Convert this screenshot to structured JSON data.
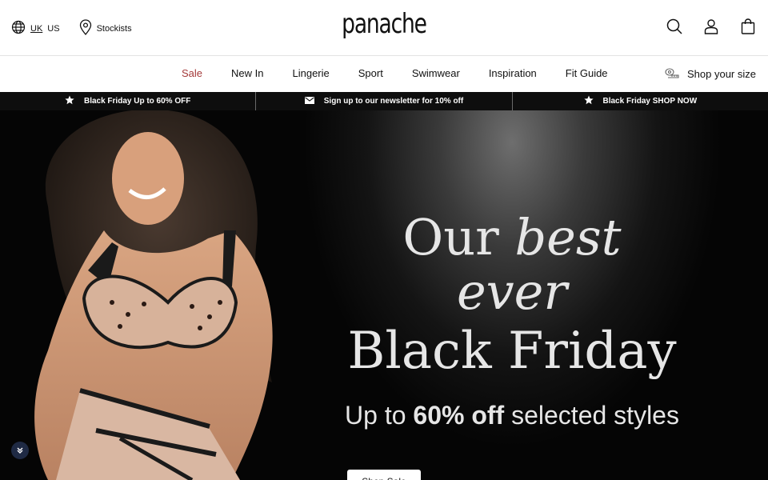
{
  "header": {
    "locale_uk": "UK",
    "locale_us": "US",
    "stockists": "Stockists",
    "logo": "panache",
    "icons": [
      "globe-icon",
      "location-pin-icon",
      "search-icon",
      "account-icon",
      "bag-icon"
    ]
  },
  "nav": {
    "items": [
      {
        "label": "Sale"
      },
      {
        "label": "New In"
      },
      {
        "label": "Lingerie"
      },
      {
        "label": "Sport"
      },
      {
        "label": "Swimwear"
      },
      {
        "label": "Inspiration"
      },
      {
        "label": "Fit Guide"
      }
    ],
    "shop_size": "Shop your size",
    "sale_color": "#a43a3a"
  },
  "promo": [
    {
      "text": "Black Friday Up to 60% OFF",
      "icon": "star-icon"
    },
    {
      "text": "Sign up to our newsletter for 10% off",
      "icon": "envelope-icon"
    },
    {
      "text": "Black Friday SHOP NOW",
      "icon": "star-icon"
    }
  ],
  "hero": {
    "line1_a": "Our ",
    "line1_b": "best ever",
    "line2": "Black Friday",
    "line3_a": "Up to ",
    "line3_b": "60% off",
    "line3_c": " selected styles",
    "cta": "Shop Sale"
  }
}
